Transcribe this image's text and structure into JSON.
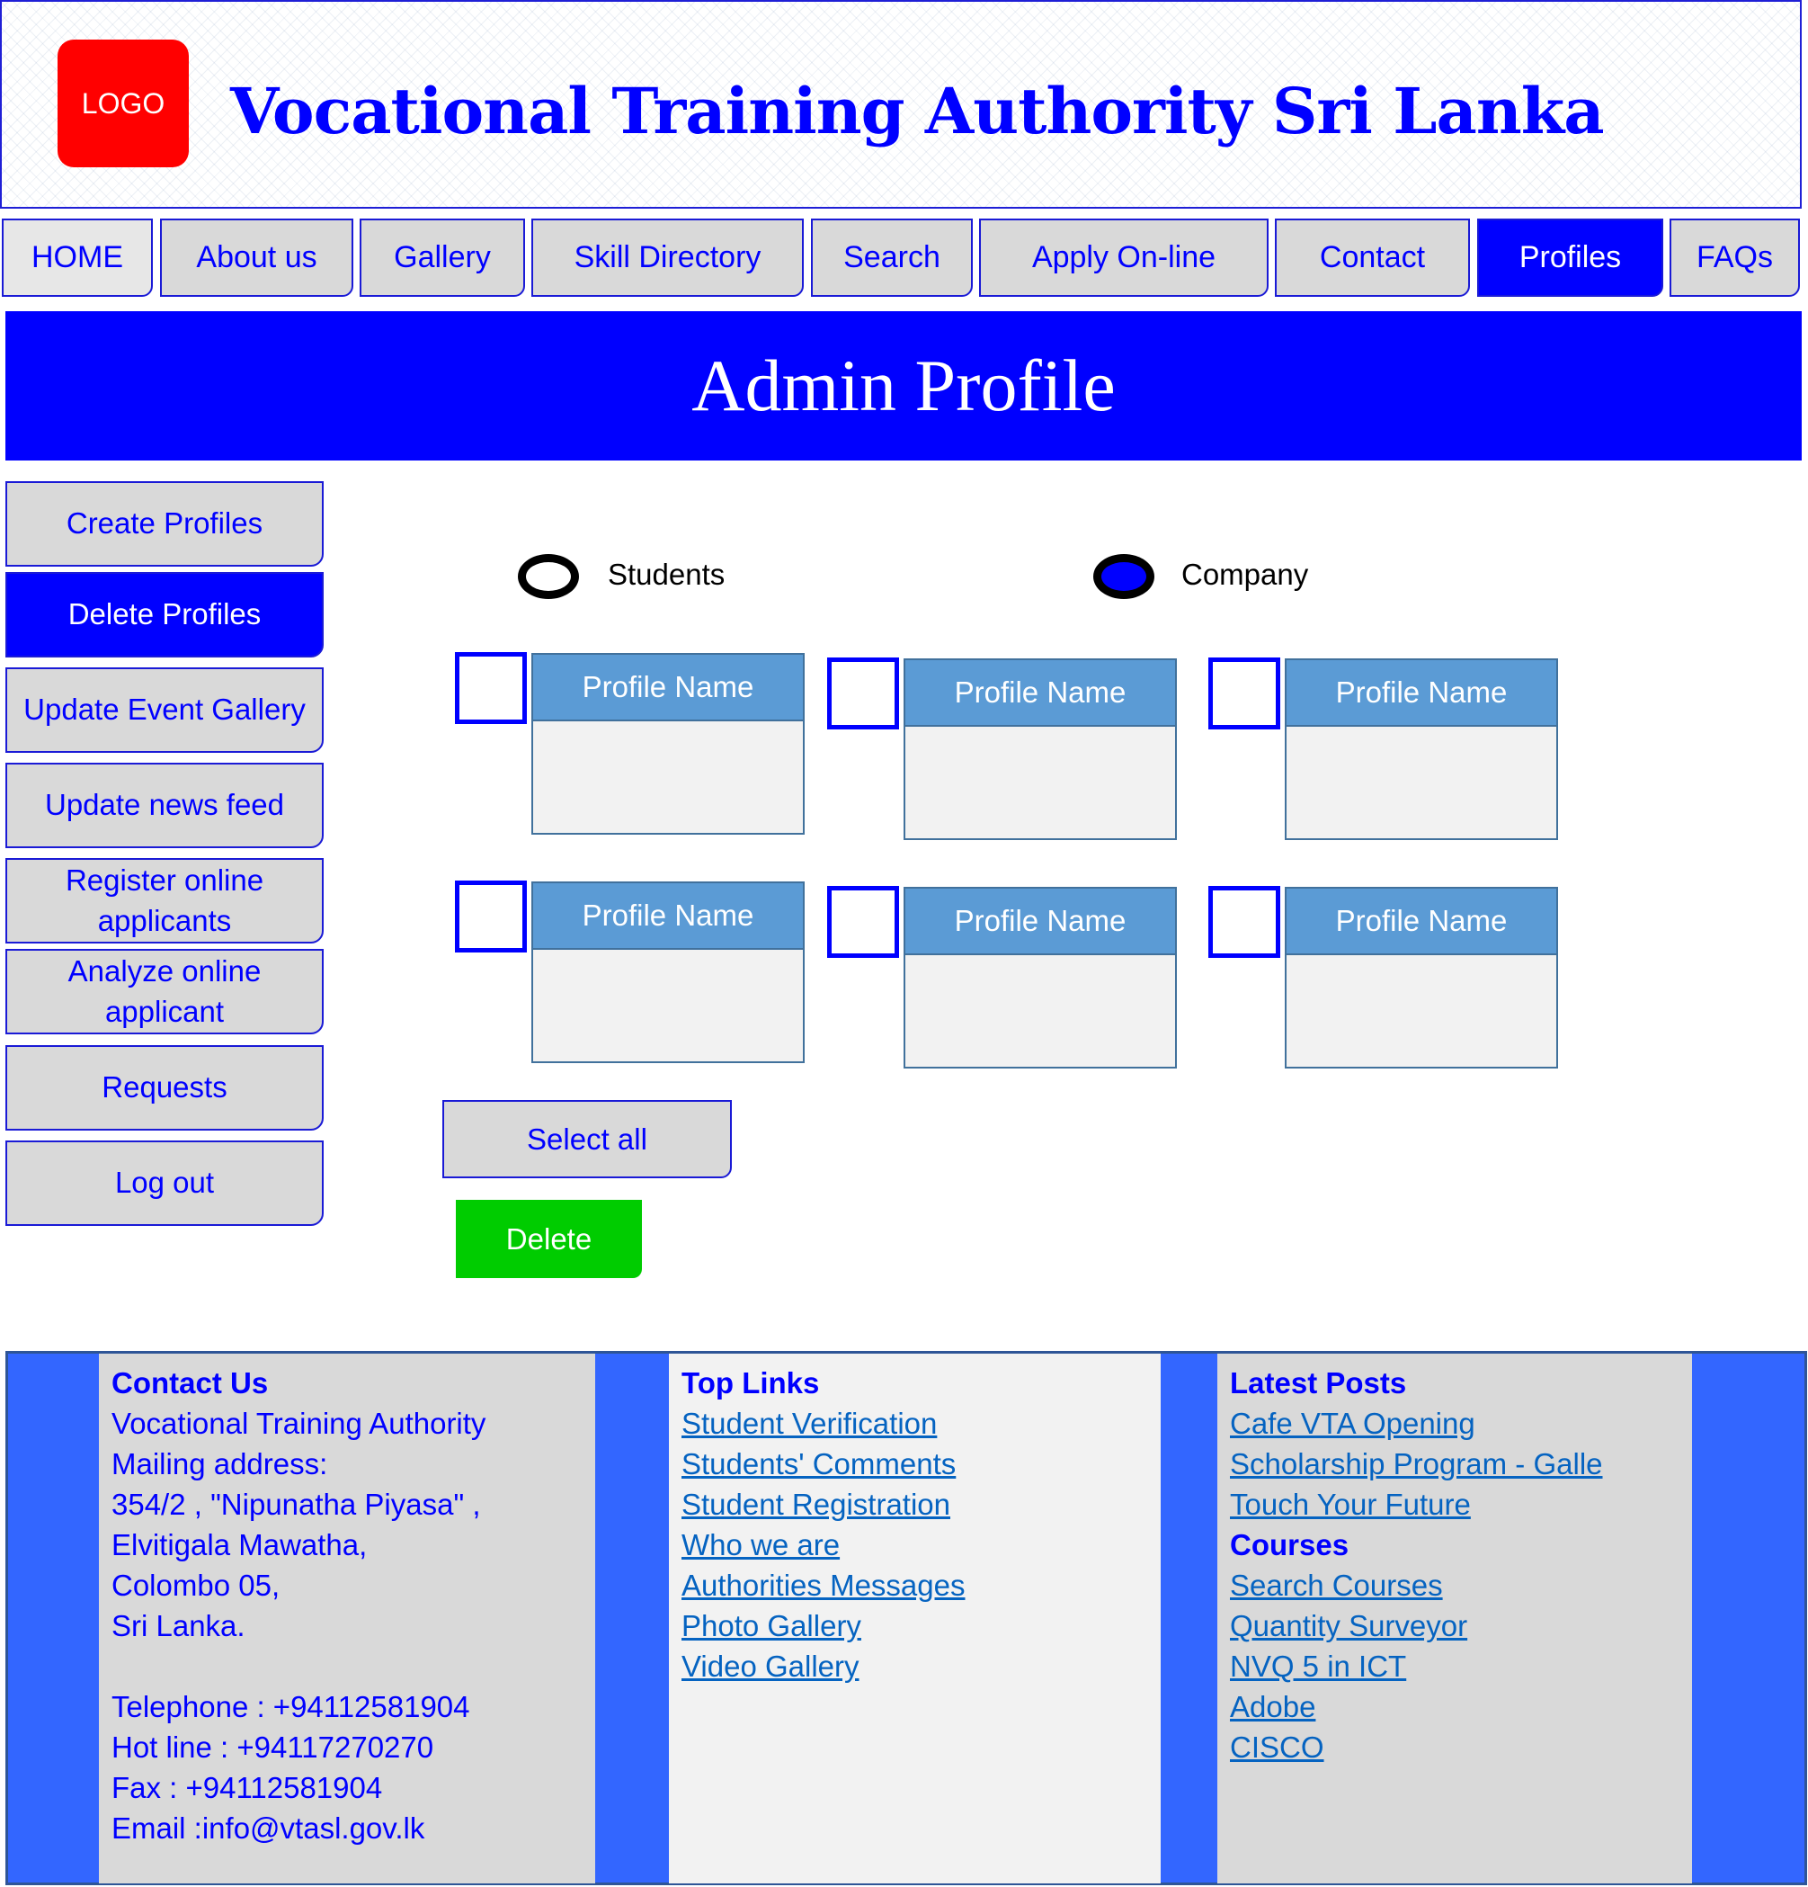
{
  "header": {
    "logo_text": "LOGO",
    "site_title": "Vocational Training Authority Sri Lanka"
  },
  "nav": {
    "items": [
      {
        "label": "HOME"
      },
      {
        "label": "About us"
      },
      {
        "label": "Gallery"
      },
      {
        "label": "Skill Directory"
      },
      {
        "label": "Search"
      },
      {
        "label": "Apply On-line"
      },
      {
        "label": "Contact"
      },
      {
        "label": "Profiles",
        "active": true
      },
      {
        "label": "FAQs"
      }
    ]
  },
  "banner": {
    "title": "Admin Profile"
  },
  "sidebar": {
    "items": [
      {
        "label": "Create Profiles"
      },
      {
        "label": "Delete Profiles",
        "active": true
      },
      {
        "label": "Update Event Gallery"
      },
      {
        "label": "Update news feed"
      },
      {
        "label": "Register online applicants"
      },
      {
        "label": "Analyze online applicant"
      },
      {
        "label": "Requests"
      },
      {
        "label": "Log out"
      }
    ]
  },
  "filter": {
    "options": [
      {
        "label": "Students",
        "selected": false
      },
      {
        "label": "Company",
        "selected": true
      }
    ]
  },
  "profiles": [
    {
      "name": "Profile Name",
      "checked": false
    },
    {
      "name": "Profile Name",
      "checked": false
    },
    {
      "name": "Profile Name",
      "checked": false
    },
    {
      "name": "Profile Name",
      "checked": false
    },
    {
      "name": "Profile Name",
      "checked": false
    },
    {
      "name": "Profile Name",
      "checked": false
    }
  ],
  "actions": {
    "select_all_label": "Select all",
    "delete_label": "Delete"
  },
  "footer": {
    "contact": {
      "heading": "Contact Us",
      "lines": [
        "Vocational Training Authority",
        "Mailing address:",
        "354/2 , \"Nipunatha Piyasa\" ,",
        "Elvitigala Mawatha,",
        "Colombo 05,",
        "Sri Lanka.",
        "",
        "Telephone : +94112581904",
        "Hot line : +94117270270",
        "Fax : +94112581904",
        "Email :info@vtasl.gov.lk"
      ]
    },
    "top_links": {
      "heading": "Top Links",
      "links": [
        "Student Verification",
        "Students' Comments",
        "Student Registration",
        "Who we are",
        "Authorities Messages",
        "Photo Gallery",
        "Video Gallery"
      ]
    },
    "latest_posts": {
      "heading": "Latest Posts",
      "links": [
        "Cafe VTA Opening",
        "Scholarship Program - Galle",
        "Touch Your Future"
      ]
    },
    "courses": {
      "heading": "Courses",
      "links": [
        "Search Courses",
        "Quantity Surveyor",
        "NVQ 5 in ICT",
        "Adobe",
        "CISCO"
      ]
    }
  },
  "colors": {
    "primary_blue": "#0000ff",
    "card_header": "#5b9bd5",
    "delete_green": "#00cc00",
    "logo_red": "#ff0000",
    "footer_blue": "#3366ff"
  }
}
